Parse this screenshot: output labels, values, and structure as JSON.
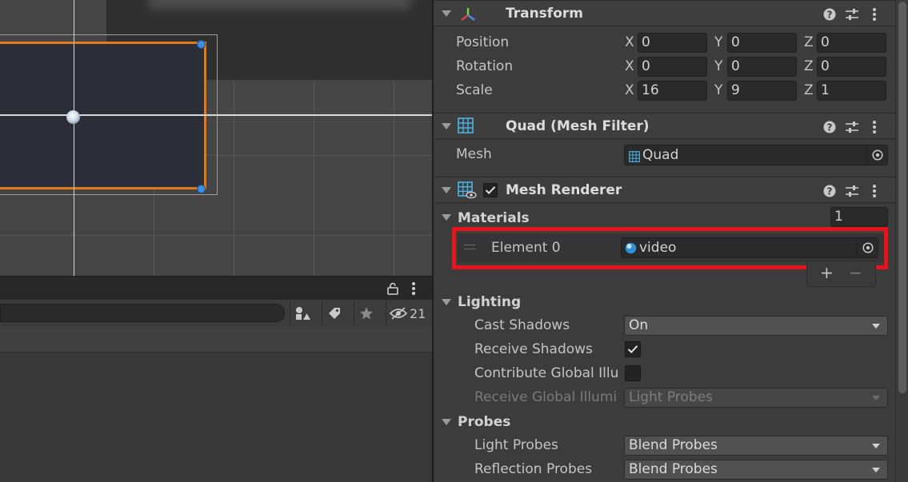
{
  "hierarchy": {
    "hidden_count": "21"
  },
  "inspector": {
    "transform": {
      "title": "Transform",
      "position": {
        "label": "Position",
        "x": "0",
        "y": "0",
        "z": "0"
      },
      "rotation": {
        "label": "Rotation",
        "x": "0",
        "y": "0",
        "z": "0"
      },
      "scale": {
        "label": "Scale",
        "x": "16",
        "y": "9",
        "z": "1"
      },
      "axis": {
        "x": "X",
        "y": "Y",
        "z": "Z"
      }
    },
    "mesh_filter": {
      "title": "Quad (Mesh Filter)",
      "mesh_label": "Mesh",
      "mesh_value": "Quad"
    },
    "mesh_renderer": {
      "title": "Mesh Renderer",
      "enabled": true,
      "materials": {
        "label": "Materials",
        "count": "1",
        "element_label": "Element 0",
        "element_value": "video",
        "add": "+",
        "remove": "−"
      },
      "lighting": {
        "label": "Lighting",
        "cast_shadows": {
          "label": "Cast Shadows",
          "value": "On"
        },
        "receive_shadows": {
          "label": "Receive Shadows",
          "checked": true
        },
        "contribute_gi": {
          "label": "Contribute Global Illu",
          "checked": false
        },
        "receive_gi": {
          "label": "Receive Global Illumi",
          "value": "Light Probes"
        }
      },
      "probes": {
        "label": "Probes",
        "light_probes": {
          "label": "Light Probes",
          "value": "Blend Probes"
        },
        "reflection_probes": {
          "label": "Reflection Probes",
          "value": "Blend Probes"
        }
      }
    }
  },
  "colors": {
    "accent_orange": "#e07a1d",
    "highlight_red": "#e8141b",
    "handle_blue": "#3d8fe4"
  }
}
